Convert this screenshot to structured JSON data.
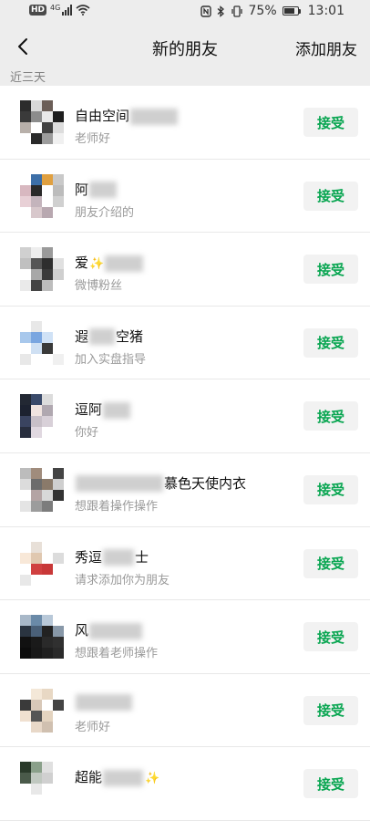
{
  "status_bar": {
    "hd": "HD",
    "network": "4G",
    "battery_percent": 75,
    "battery_text": "75%",
    "time": "13:01"
  },
  "header": {
    "title": "新的朋友",
    "add_friend": "添加朋友"
  },
  "section": {
    "label": "近三天"
  },
  "accept_label": "接受",
  "requests": [
    {
      "name": "自由空间",
      "message": "老师好"
    },
    {
      "name": "阿",
      "message": "朋友介绍的"
    },
    {
      "name": "爱",
      "message": "微博粉丝"
    },
    {
      "name": "遐",
      "name_suffix": "空猪",
      "message": "加入实盘指导"
    },
    {
      "name": "逗阿",
      "message": "你好"
    },
    {
      "name": "",
      "name_suffix": "慕色天使内衣",
      "message": "想跟着操作操作"
    },
    {
      "name": "秀逗",
      "name_suffix": "士",
      "message": "请求添加你为朋友"
    },
    {
      "name": "风",
      "message": "想跟着老师操作"
    },
    {
      "name": "",
      "message": "老师好"
    },
    {
      "name": "超能",
      "name_suffix": "",
      "message": ""
    }
  ],
  "icons": {
    "back": "chevron-left-icon",
    "wifi": "wifi-icon",
    "signal": "signal-icon",
    "nfc": "nfc-icon",
    "bluetooth": "bluetooth-icon",
    "vibrate": "vibrate-icon",
    "battery": "battery-icon"
  },
  "colors": {
    "accept_text": "#07a550",
    "background": "#ededed"
  }
}
